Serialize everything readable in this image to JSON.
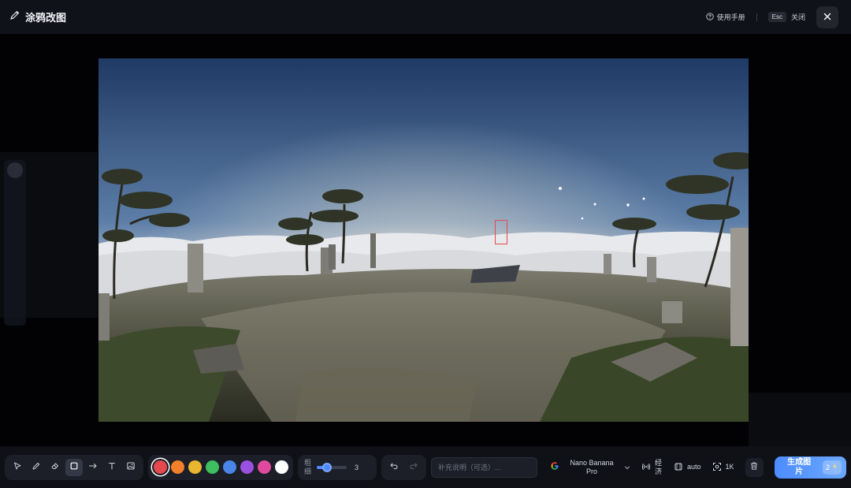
{
  "header": {
    "title": "涂鸦改图",
    "manual_label": "使用手册",
    "esc_key": "Esc",
    "close_label": "关闭"
  },
  "toolbar": {
    "tools": [
      "select-icon",
      "pen-icon",
      "eraser-icon",
      "rectangle-icon",
      "arrow-icon",
      "text-icon",
      "image-icon"
    ],
    "active_tool": "rectangle-icon",
    "colors": [
      "#e5484d",
      "#f0812a",
      "#e8b72f",
      "#3fbf5f",
      "#4a86e8",
      "#9b51e0",
      "#e04a9e",
      "#ffffff"
    ],
    "selected_color": "#e5484d",
    "size_label": "粗细",
    "size_value": "3",
    "size_level_percent": 35,
    "prompt_placeholder": "补充说明（可选）...",
    "model_name": "Nano Banana Pro",
    "mode_label": "经济",
    "aspect_label": "auto",
    "resolution_label": "1K",
    "generate_label": "生成图片",
    "generate_cost": "2"
  }
}
